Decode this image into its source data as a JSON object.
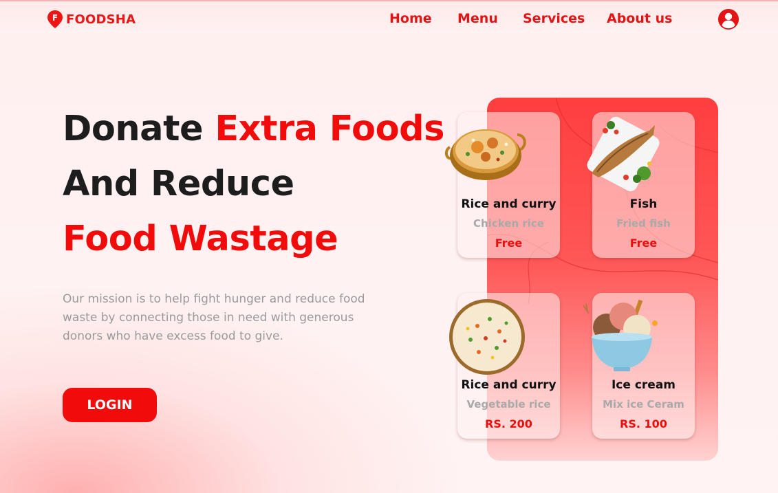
{
  "brand": {
    "name": "FOODSHA",
    "logo_letter": "F",
    "color": "#f01515"
  },
  "nav": {
    "items": [
      {
        "label": "Home"
      },
      {
        "label": "Menu"
      },
      {
        "label": "Services"
      },
      {
        "label": "About us"
      }
    ],
    "user_icon": "user-circle-icon"
  },
  "hero": {
    "line1_dark": "Donate ",
    "line1_red": "Extra Foods",
    "line2": "And Reduce",
    "line3": "Food Wastage",
    "mission": "Our mission is to help fight hunger and reduce food waste by connecting those in need with generous donors who have excess food to give.",
    "login_label": "LOGIN"
  },
  "cards": [
    {
      "title": "Rice and curry",
      "subtitle": "Chicken rice",
      "price": "Free",
      "image": "biryani-bowl"
    },
    {
      "title": "Fish",
      "subtitle": "Fried fish",
      "price": "Free",
      "image": "fried-fish-plate"
    },
    {
      "title": "Rice and curry",
      "subtitle": "Vegetable rice",
      "price": "RS. 200",
      "image": "vegetable-rice-plate"
    },
    {
      "title": "Ice cream",
      "subtitle": "Mix ice Ceram",
      "price": "RS. 100",
      "image": "ice-cream-bowl"
    }
  ],
  "colors": {
    "accent": "#f20b0b",
    "text_dark": "#1d1d1d",
    "muted": "#9a9a9a",
    "panel": "#ff4d4d"
  }
}
